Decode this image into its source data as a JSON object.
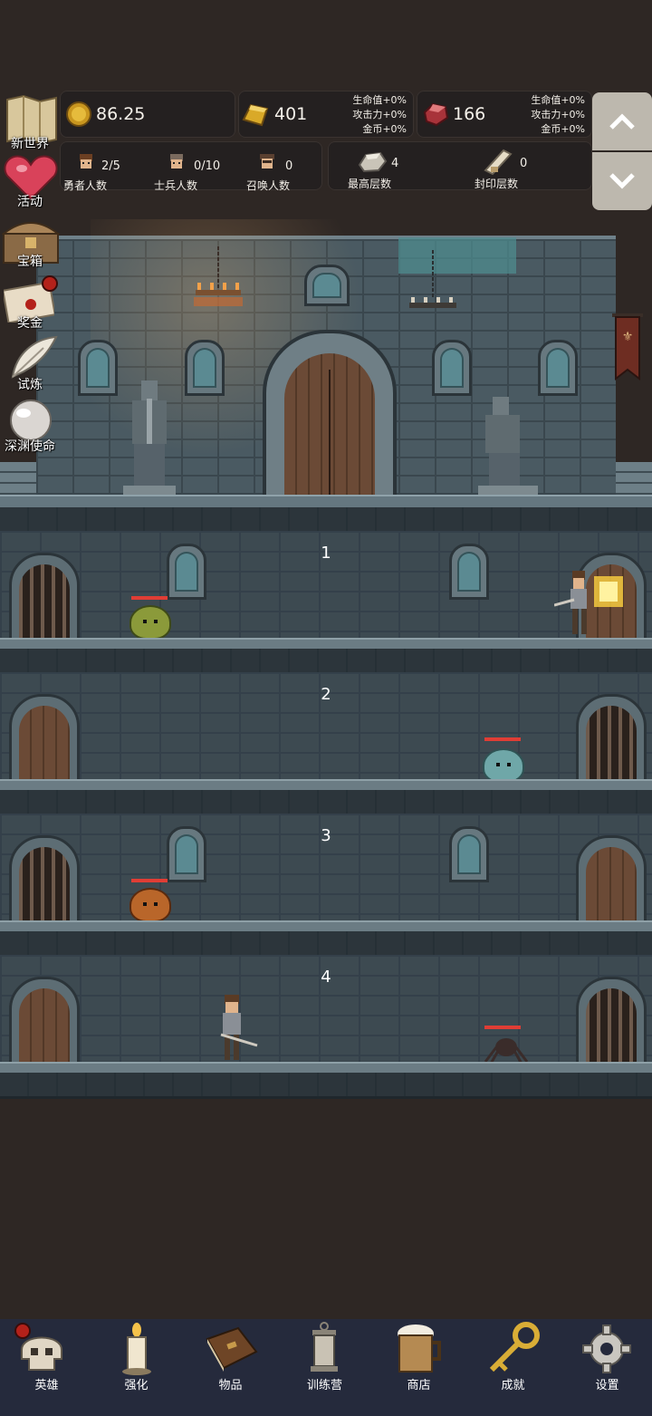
{
  "resources": {
    "gold": {
      "value": "86.25",
      "icon": "gold-coin-icon"
    },
    "bar": {
      "value": "401",
      "icon": "gold-bar-icon",
      "bonuses": [
        "生命值+0%",
        "攻击力+0%",
        "金币+0%"
      ]
    },
    "gem": {
      "value": "166",
      "icon": "red-gem-icon",
      "bonuses": [
        "生命值+0%",
        "攻击力+0%",
        "金币+0%"
      ]
    }
  },
  "counters": {
    "heroes": {
      "value": "2/5",
      "label": "勇者人数"
    },
    "soldiers": {
      "value": "0/10",
      "label": "士兵人数"
    },
    "summons": {
      "value": "0",
      "label": "召唤人数"
    },
    "max_floor": {
      "value": "4",
      "label": "最高层数"
    },
    "sealed_floor": {
      "value": "0",
      "label": "封印层数"
    }
  },
  "side_menu": [
    {
      "label": "新世界",
      "icon": "map-scroll-icon"
    },
    {
      "label": "活动",
      "icon": "heart-icon"
    },
    {
      "label": "宝箱",
      "icon": "treasure-chest-icon"
    },
    {
      "label": "奖金",
      "icon": "envelope-icon"
    },
    {
      "label": "试炼",
      "icon": "feather-icon"
    },
    {
      "label": "深渊使命",
      "icon": "pearl-icon"
    }
  ],
  "floors": [
    {
      "number": "1"
    },
    {
      "number": "2"
    },
    {
      "number": "3"
    },
    {
      "number": "4"
    }
  ],
  "nav": [
    {
      "label": "英雄",
      "icon": "skull-icon"
    },
    {
      "label": "强化",
      "icon": "candle-icon"
    },
    {
      "label": "物品",
      "icon": "book-icon"
    },
    {
      "label": "训练营",
      "icon": "lantern-icon"
    },
    {
      "label": "商店",
      "icon": "beer-mug-icon"
    },
    {
      "label": "成就",
      "icon": "key-icon"
    },
    {
      "label": "设置",
      "icon": "gear-icon"
    }
  ],
  "colors": {
    "background": "#2e2724",
    "nav": "#252a3c",
    "badge": "#b3211a",
    "hp": "#e03d35"
  }
}
